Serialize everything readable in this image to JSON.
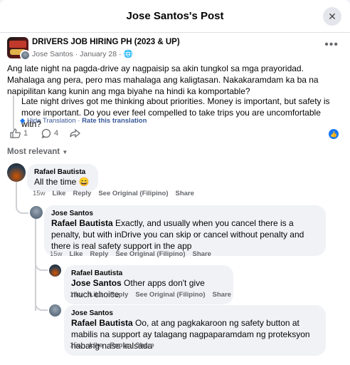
{
  "header": {
    "title": "Jose Santos's Post",
    "close_icon": "close-icon"
  },
  "post": {
    "group_name": "DRIVERS JOB HIRING PH (2023 & UP)",
    "author": "Jose Santos",
    "date": "January 28",
    "privacy_icon": "globe-icon",
    "text": "Ang late night na pagda-drive ay nagpaisip sa akin tungkol sa mga prayoridad. Mahalaga ang pera, pero mas mahalaga ang kaligtasan. Nakakaramdam ka ba na napipilitan kang kunin ang mga biyahe na hindi ka komportable?",
    "translation": "Late night drives got me thinking about priorities. Money is important, but safety is more important. Do you ever feel compelled to take trips you are uncomfortable with?",
    "hide_translation": "Hide Translation",
    "rate_translation": "Rate this translation",
    "separator": "·",
    "like_count": "1",
    "comment_count": "4"
  },
  "sort_label": "Most relevant",
  "comments": [
    {
      "author": "Rafael Bautista",
      "text": "All the time 😄",
      "time": "15w",
      "like": "Like",
      "reply": "Reply",
      "see_original": "See Original (Filipino)",
      "share": "Share"
    },
    {
      "author": "Jose Santos",
      "mention": "Rafael Bautista",
      "text": "Exactly, and usually when you cancel there is a penalty, but with inDrive you can skip or cancel without penalty and there is real safety support in the app",
      "time": "15w",
      "like": "Like",
      "reply": "Reply",
      "see_original": "See Original (Filipino)",
      "share": "Share"
    },
    {
      "author": "Rafael Bautista",
      "mention": "Jose Santos",
      "text": "Other apps don't give much choice",
      "time": "15w",
      "like": "Like",
      "reply": "Reply",
      "see_original": "See Original (Filipino)",
      "share": "Share"
    },
    {
      "author": "Jose Santos",
      "mention": "Rafael Bautista",
      "text": "Oo, at ang pagkakaroon ng safety button at mabilis na support ay talagang nagpaparamdam ng proteksyon habang nasa kalsada",
      "time": "15w",
      "like": "Like",
      "reply": "Reply",
      "share": "Share"
    }
  ],
  "colors": {
    "accent": "#1877f2",
    "muted": "#65676b",
    "bubble": "#f0f2f5"
  }
}
